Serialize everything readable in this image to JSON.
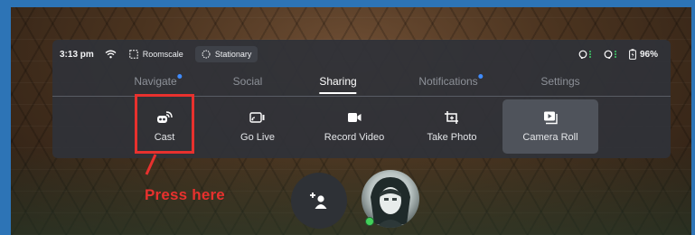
{
  "status": {
    "time": "3:13 pm",
    "boundary_mode": "Roomscale",
    "stationary_label": "Stationary",
    "battery": "96%"
  },
  "tabs": [
    {
      "label": "Navigate",
      "badge": true
    },
    {
      "label": "Social",
      "badge": false
    },
    {
      "label": "Sharing",
      "badge": false,
      "active": true
    },
    {
      "label": "Notifications",
      "badge": true
    },
    {
      "label": "Settings",
      "badge": false
    }
  ],
  "actions": [
    {
      "label": "Cast",
      "icon": "cast-icon"
    },
    {
      "label": "Go Live",
      "icon": "go-live-icon"
    },
    {
      "label": "Record Video",
      "icon": "record-video-icon"
    },
    {
      "label": "Take Photo",
      "icon": "take-photo-icon"
    },
    {
      "label": "Camera Roll",
      "icon": "camera-roll-icon",
      "selected": true
    }
  ],
  "annotation": {
    "label": "Press here",
    "color": "#e8312e"
  },
  "colors": {
    "accent_blue": "#3f8cff",
    "online_green": "#43d05a",
    "frame_blue": "#2d74b6"
  }
}
